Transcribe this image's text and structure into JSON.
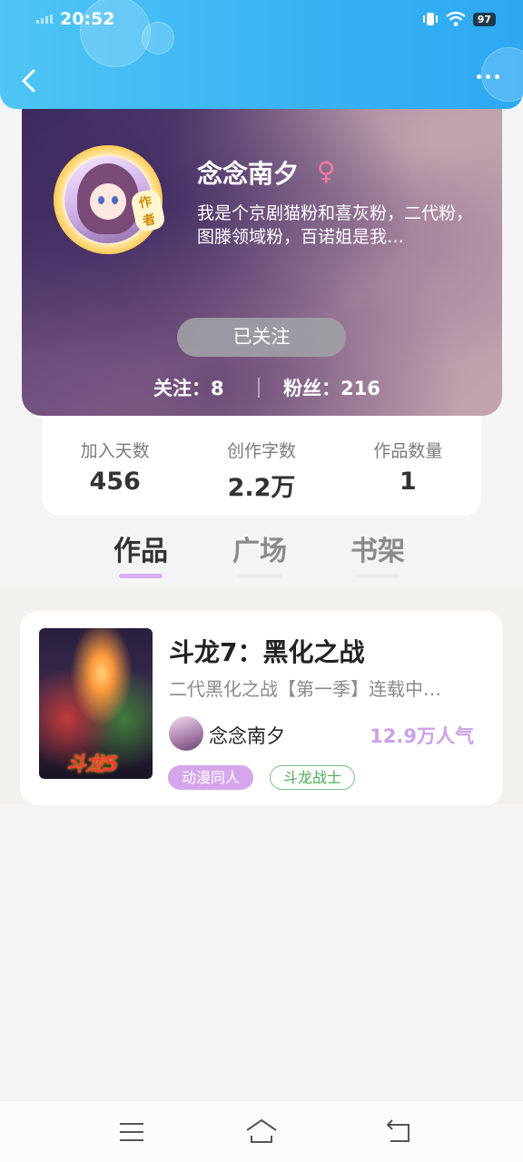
{
  "status_bar": {
    "time": "20:52",
    "battery": "97"
  },
  "header": {
    "back_icon": "chevron-left-icon",
    "more_icon": "more-dots-icon"
  },
  "profile": {
    "author_badge": "作者",
    "username": "念念南夕",
    "gender_symbol": "♀",
    "bio": "我是个京剧猫粉和喜灰粉，二代粉，图滕领域粉，百诺姐是我…",
    "follow_label": "已关注",
    "following": "关注：8",
    "fans": "粉丝：216"
  },
  "stats": [
    {
      "label": "加入天数",
      "value": "456"
    },
    {
      "label": "创作字数",
      "value": "2.2万"
    },
    {
      "label": "作品数量",
      "value": "1"
    }
  ],
  "tabs": [
    {
      "label": "作品",
      "active": true
    },
    {
      "label": "广场",
      "active": false
    },
    {
      "label": "书架",
      "active": false
    }
  ],
  "book": {
    "cover_text": "斗龙5",
    "title": "斗龙7：黑化之战",
    "description": "二代黑化之战【第一季】连载中…",
    "author": "念念南夕",
    "popularity": "12.9万人气",
    "tags": [
      "动漫同人",
      "斗龙战士"
    ]
  },
  "colors": {
    "header": "#38b2f3",
    "accent": "#caa2e6",
    "tag_purple": "#d6a6ec",
    "tag_green": "#4caa55"
  }
}
